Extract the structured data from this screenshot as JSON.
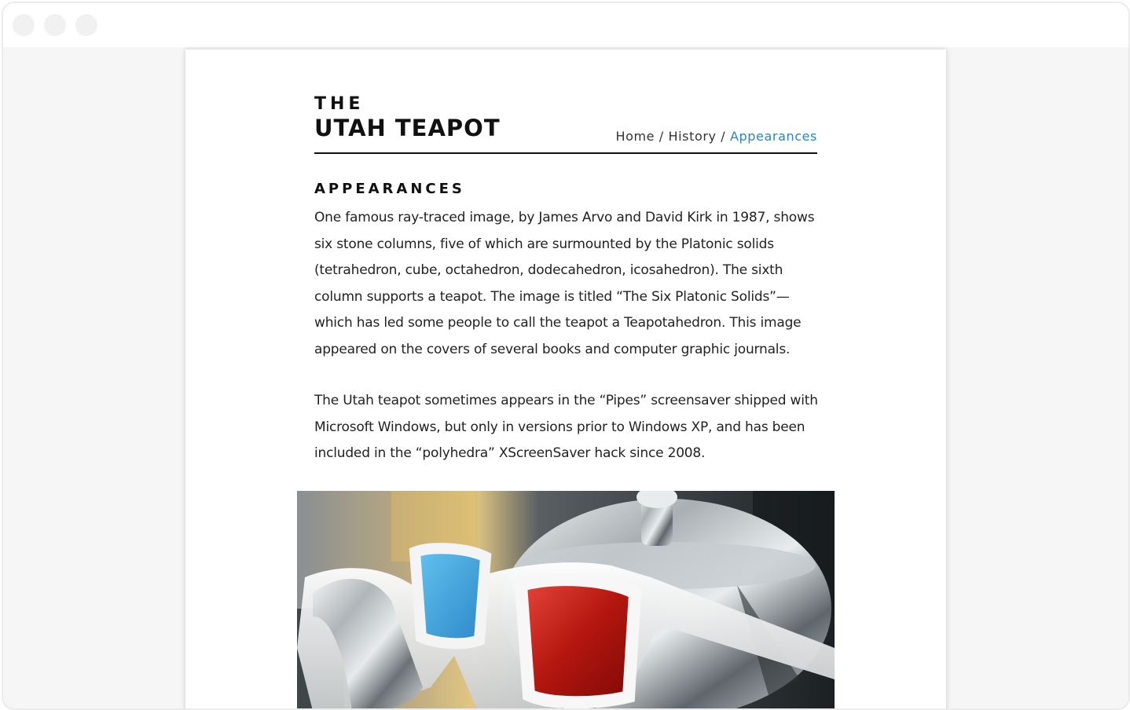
{
  "site": {
    "logo_line1": "THE",
    "logo_line2": "UTAH TEAPOT"
  },
  "breadcrumb": {
    "home": "Home",
    "history": "History",
    "current": "Appearances",
    "separator": "/"
  },
  "section": {
    "title": "APPEARANCES",
    "paragraph1": "One famous ray-traced image, by James Arvo and David Kirk in 1987, shows six stone columns, five of which are surmounted by the Platonic solids (tetrahedron, cube, octahedron, dodecahedron, icosahedron). The sixth column supports a teapot. The image is titled “The Six Platonic Solids”—which has led some people to call the teapot a Teapotahedron. This image appeared on the covers of several books and computer graphic journals.",
    "paragraph2": "The Utah teapot sometimes appears in the “Pipes” screensaver shipped with Microsoft Windows, but only in versions prior to Windows XP, and has been included in the “polyhedra” XScreenSaver hack since 2008."
  },
  "colors": {
    "accent_link": "#2a86c8",
    "text": "#222222",
    "page_bg": "#ffffff",
    "window_bg": "#f6f6f6"
  },
  "icons": {
    "window_controls": [
      "window-dot-icon",
      "window-dot-icon",
      "window-dot-icon"
    ]
  }
}
